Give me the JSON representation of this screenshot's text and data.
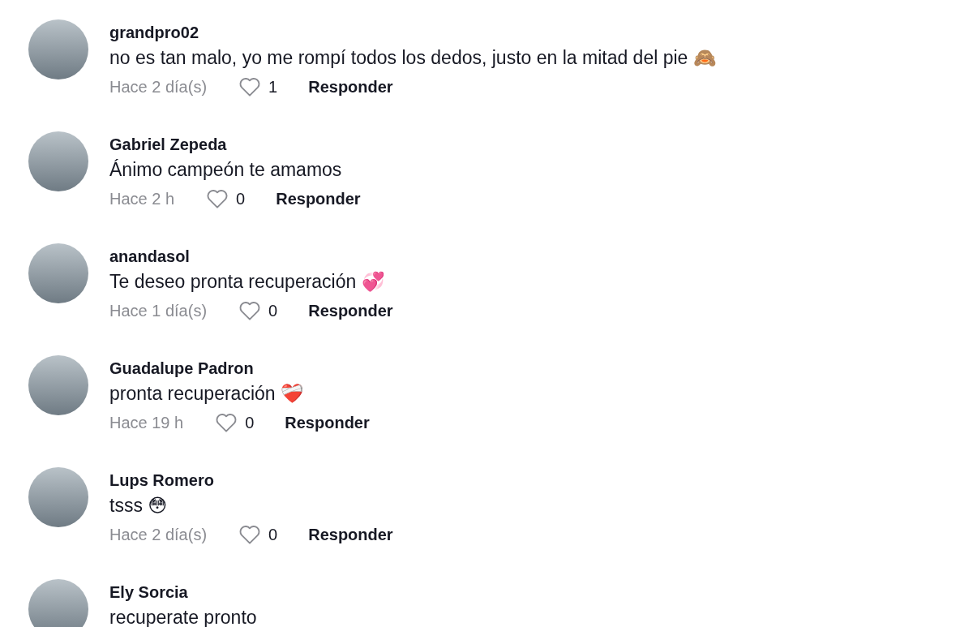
{
  "comments": [
    {
      "username": "grandpro02",
      "text": "no es tan malo, yo me rompí todos los dedos, justo en la mitad del pie 🙈",
      "time": "Hace 2 día(s)",
      "likes": "1",
      "reply": "Responder"
    },
    {
      "username": "Gabriel Zepeda",
      "text": "Ánimo campeón te amamos",
      "time": "Hace 2 h",
      "likes": "0",
      "reply": "Responder"
    },
    {
      "username": "anandasol",
      "text": "Te deseo pronta recuperación 💞",
      "time": "Hace 1 día(s)",
      "likes": "0",
      "reply": "Responder"
    },
    {
      "username": "Guadalupe Padron",
      "text": "pronta recuperación ❤️‍🩹",
      "time": "Hace 19 h",
      "likes": "0",
      "reply": "Responder"
    },
    {
      "username": "Lups Romero",
      "text": "tsss 😳",
      "time": "Hace 2 día(s)",
      "likes": "0",
      "reply": "Responder"
    },
    {
      "username": "Ely Sorcia",
      "text": "recuperate pronto"
    }
  ]
}
